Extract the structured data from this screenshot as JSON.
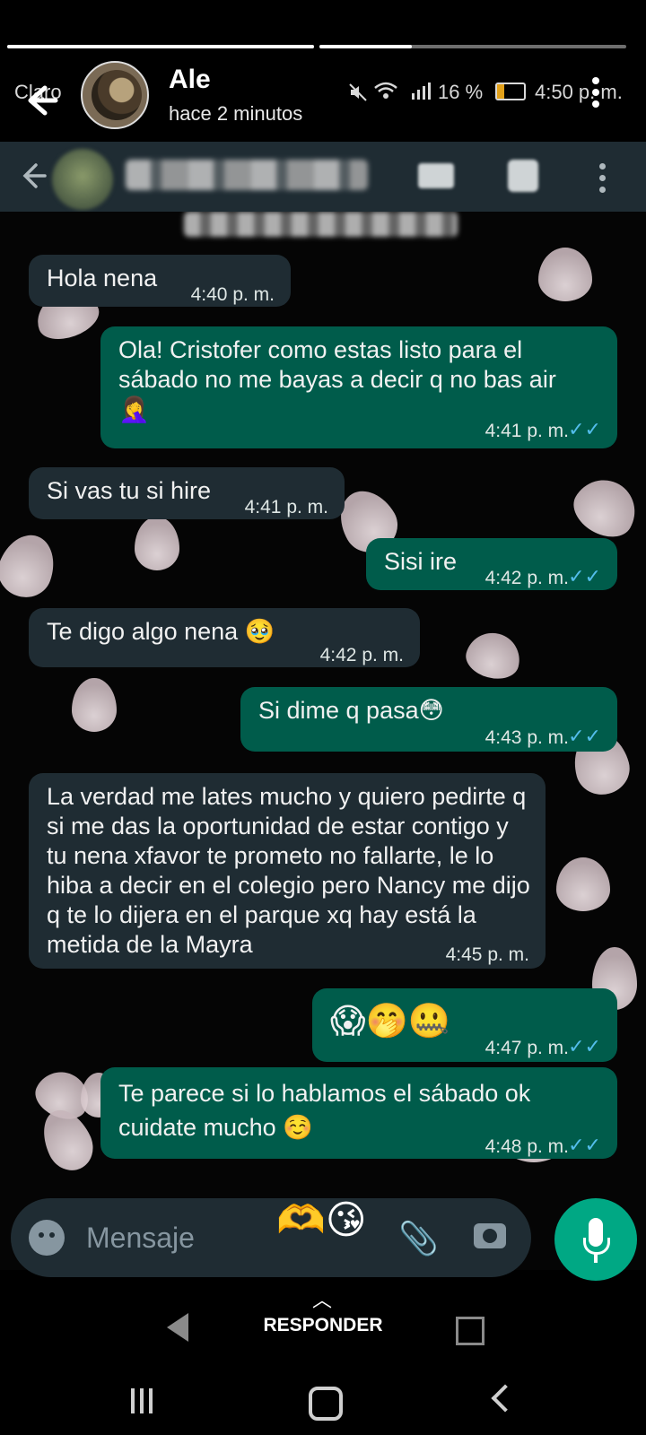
{
  "story": {
    "progress": [
      1.0,
      0.3
    ],
    "name": "Ale",
    "time": "hace 2 minutos"
  },
  "status_bar": {
    "carrier": "Claro",
    "signal_battery": "16 %",
    "time": "4:50 p. m."
  },
  "messages": [
    {
      "dir": "in",
      "text": "Hola nena",
      "time": "4:40 p. m."
    },
    {
      "dir": "out",
      "text": "Ola! Cristofer como estas listo para el sábado no me bayas a decir q no bas air",
      "emoji": "🤦‍♀️",
      "time": "4:41 p. m."
    },
    {
      "dir": "in",
      "text": "Si vas tu si hire",
      "time": "4:41 p. m."
    },
    {
      "dir": "out",
      "text": "Sisi ire",
      "time": "4:42 p. m."
    },
    {
      "dir": "in",
      "text": "Te digo algo nena 🥹",
      "time": "4:42 p. m."
    },
    {
      "dir": "out",
      "text": "Si dime q pasa😳",
      "time": "4:43 p. m."
    },
    {
      "dir": "in",
      "text": "La verdad me lates mucho y quiero pedirte q si me das la oportunidad de estar contigo y tu nena xfavor te prometo no fallarte, le lo hiba a decir en el colegio pero Nancy me dijo q te lo dijera en el parque xq hay está la metida de la Mayra",
      "time": "4:45 p. m."
    },
    {
      "dir": "out",
      "text": "😱🤭🤐",
      "time": "4:47 p. m."
    },
    {
      "dir": "out",
      "text": "Te parece si lo hablamos el sábado ok cuidate mucho ☺️",
      "time": "4:48 p. m."
    }
  ],
  "input": {
    "placeholder": "Mensaje",
    "reactions": "🫶😘"
  },
  "reply": {
    "label": "RESPONDER"
  },
  "icons": [
    "back-arrow-icon",
    "more-vert-icon",
    "video-call-icon",
    "voice-call-icon",
    "emoji-icon",
    "attach-icon",
    "camera-icon",
    "mic-icon",
    "chevron-up-icon",
    "nav-back-icon",
    "nav-home-icon",
    "nav-recents-icon"
  ],
  "colors": {
    "incoming_bubble": "#1f2c33",
    "outgoing_bubble": "#005c4b",
    "mic_button": "#00a884",
    "read_ticks": "#53bdeb"
  }
}
